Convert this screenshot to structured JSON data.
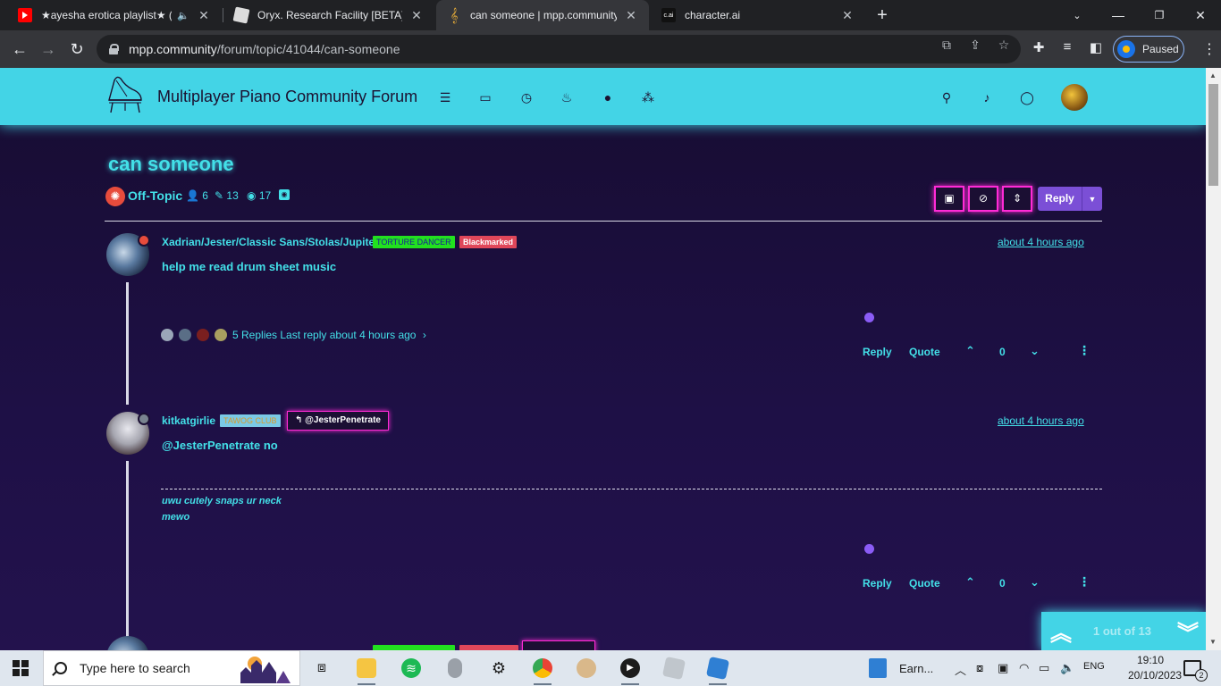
{
  "browser": {
    "tabs": [
      {
        "title": "★ayesha erotica playlist★ (M",
        "favicon": "youtube-icon",
        "color": "#ff0000",
        "active": false
      },
      {
        "title": "Oryx. Research Facility [BETA] - R",
        "favicon": "roblox-icon",
        "color": "#dcdcdc",
        "active": false
      },
      {
        "title": "can someone | mpp.community",
        "favicon": "treble-clef-icon",
        "color": "#e0a838",
        "active": true
      },
      {
        "title": "character.ai",
        "favicon": "cai-icon",
        "color": "#111111",
        "active": false
      }
    ],
    "cai_label": "c.ai",
    "url_host": "mpp.community",
    "url_path": "/forum/topic/41044/can-someone",
    "profile_label": "Paused"
  },
  "site": {
    "title": "Multiplayer Piano Community Forum",
    "nav_icons": [
      "list-icon",
      "inbox-icon",
      "clock-icon",
      "fire-icon",
      "user-icon",
      "group-icon"
    ],
    "right_icons": [
      "search-icon",
      "bell-icon",
      "chat-icon"
    ]
  },
  "topic": {
    "title": "can someone",
    "category": "Off-Topic",
    "posters": "6",
    "posts": "13",
    "views": "17",
    "reply_label": "Reply"
  },
  "posts": [
    {
      "username": "Xadrian/Jester/Classic Sans/Stolas/Jupiter",
      "badges": [
        {
          "label": "TORTURE DANCER",
          "bg": "#22e11f",
          "fg": "#1a1a9a"
        },
        {
          "label": "Blackmarked",
          "bg": "#e0475a",
          "fg": "#ffffff"
        }
      ],
      "timestamp": "about 4 hours ago",
      "content": "help me read drum sheet music",
      "replies_text": "5 Replies Last reply about 4 hours ago",
      "reply_label": "Reply",
      "quote_label": "Quote",
      "votes": "0",
      "status_color": "#e74c3c"
    },
    {
      "username": "kitkatgirlie",
      "badges": [
        {
          "label": "TAWOG CLUB",
          "bg": "#7ac9e6",
          "fg": "#d89a2a"
        }
      ],
      "reply_to": "@JesterPenetrate",
      "timestamp": "about 4 hours ago",
      "content": "@JesterPenetrate no",
      "signature": [
        "uwu cutely snaps ur neck",
        "mewo"
      ],
      "reply_label": "Reply",
      "quote_label": "Quote",
      "votes": "0",
      "status_color": "#7a8490"
    }
  ],
  "paginator": {
    "text": "1 out of 13"
  },
  "taskbar": {
    "search_placeholder": "Type here to search",
    "earn_label": "Earn...",
    "lang": "ENG",
    "time": "19:10",
    "date": "20/10/2023",
    "notifications": "2"
  }
}
